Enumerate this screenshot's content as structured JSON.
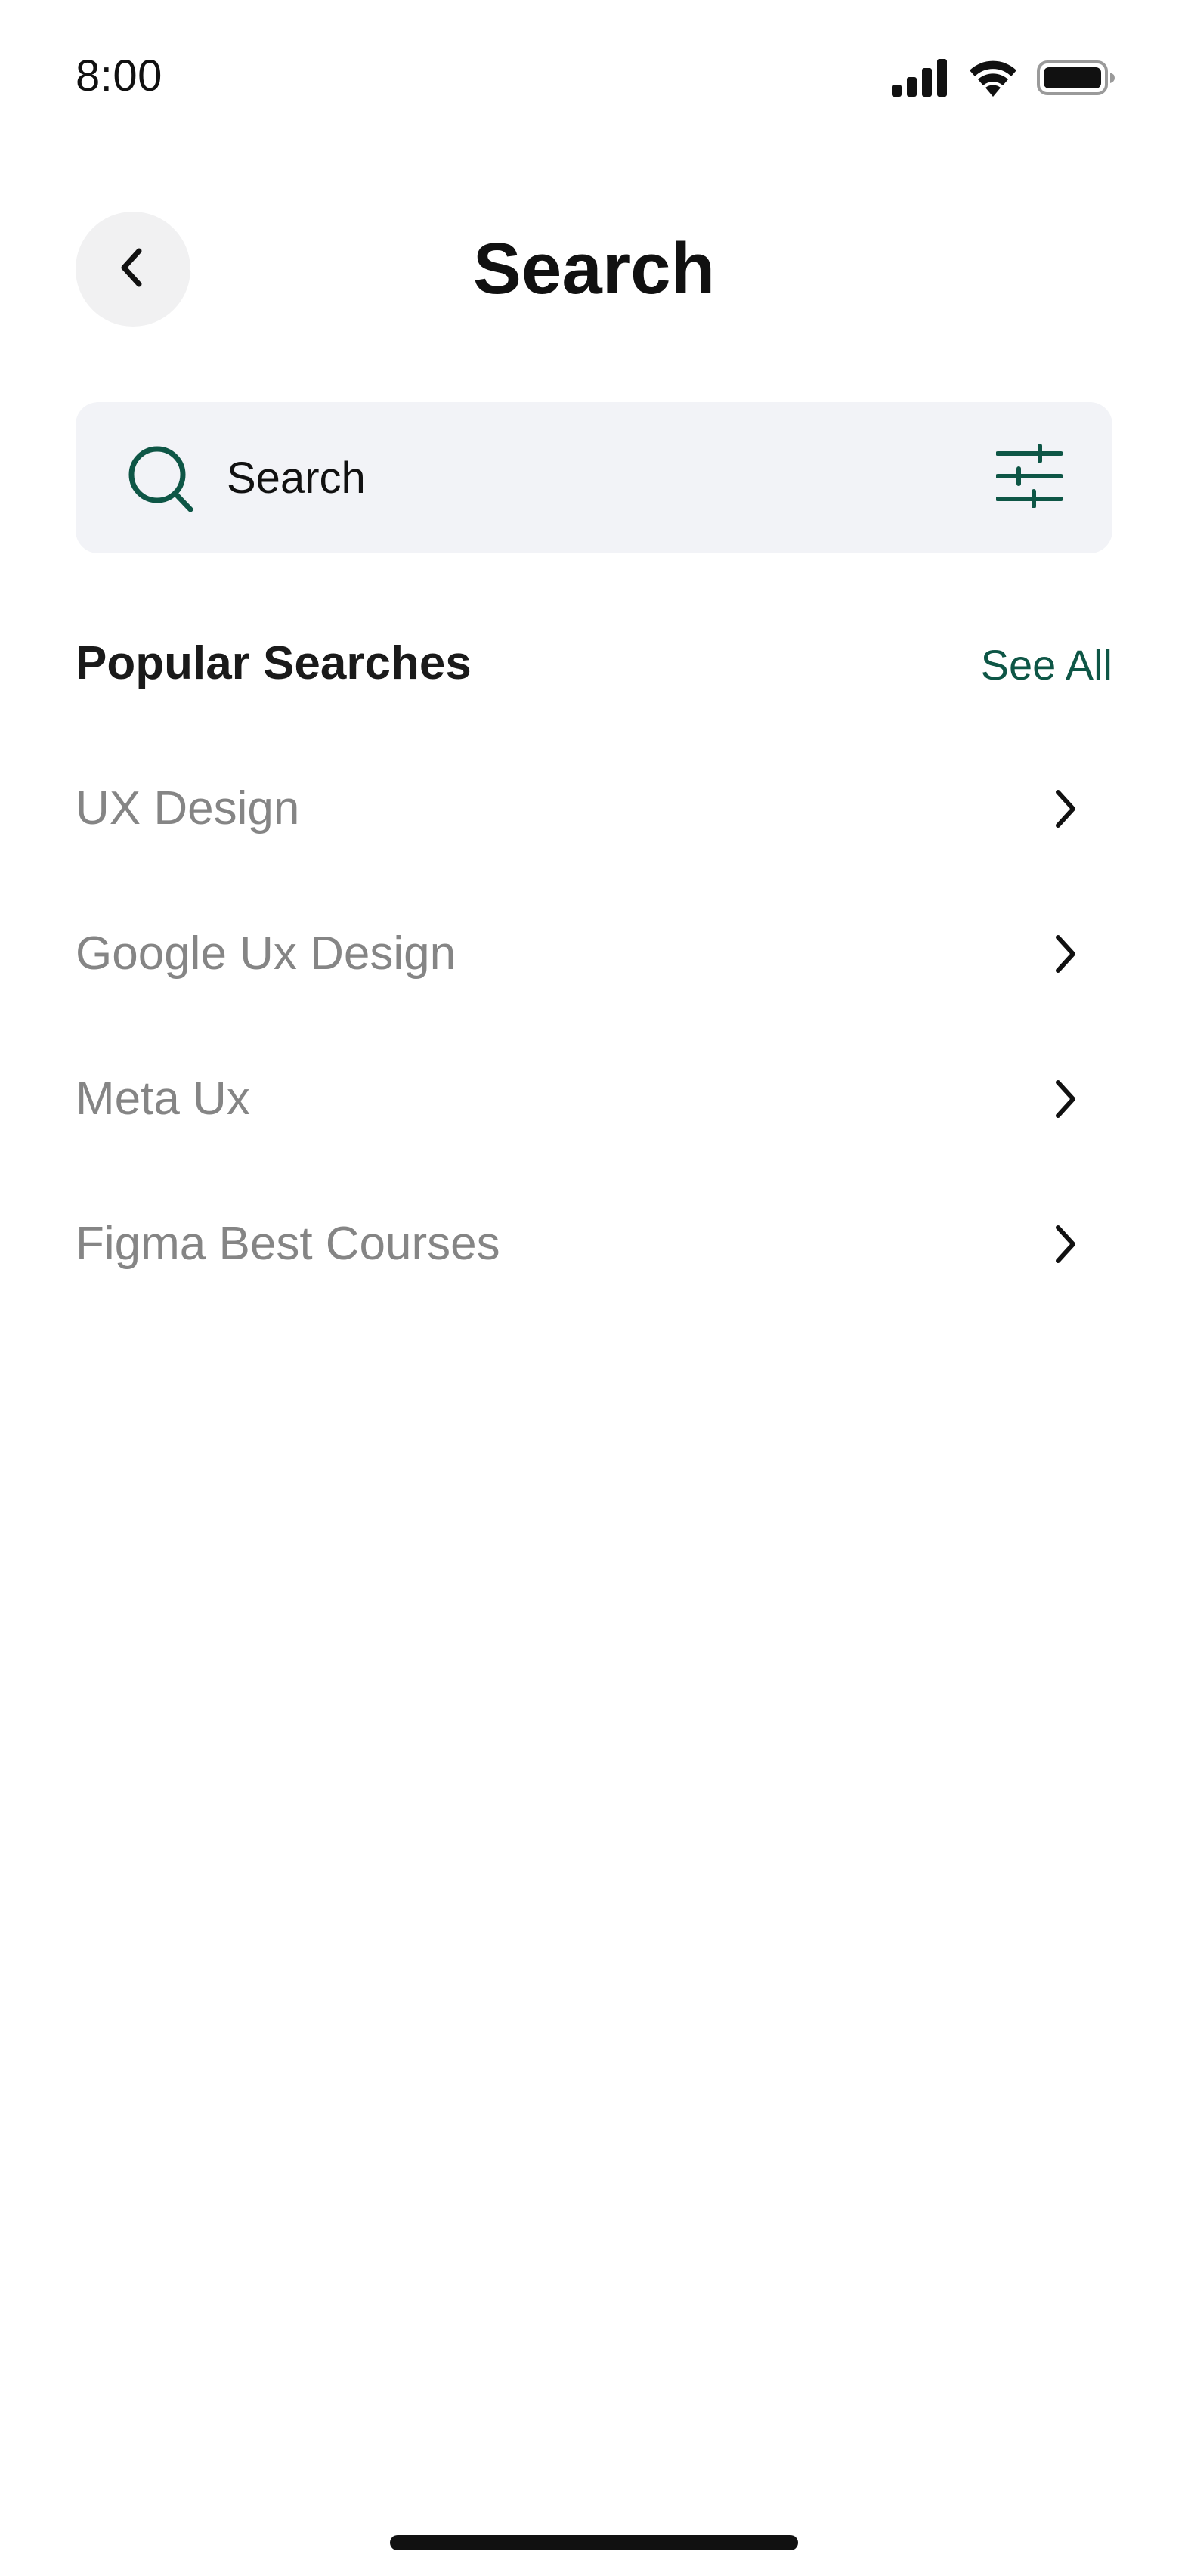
{
  "status_bar": {
    "time": "8:00",
    "icons": [
      "signal-icon",
      "wifi-icon",
      "battery-icon"
    ]
  },
  "header": {
    "back_icon": "chevron-left-icon",
    "title": "Search"
  },
  "search": {
    "placeholder": "Search",
    "icon": "search-icon",
    "filter_icon": "sliders-icon"
  },
  "popular": {
    "title": "Popular Searches",
    "see_all_label": "See All",
    "items": [
      {
        "label": "UX Design"
      },
      {
        "label": "Google Ux Design"
      },
      {
        "label": "Meta Ux"
      },
      {
        "label": "Figma Best Courses"
      }
    ]
  },
  "colors": {
    "accent": "#0e5646",
    "text_primary": "#111111",
    "text_muted": "#858585",
    "search_bg": "#f2f3f7",
    "back_button_bg": "#f1f1f2"
  }
}
